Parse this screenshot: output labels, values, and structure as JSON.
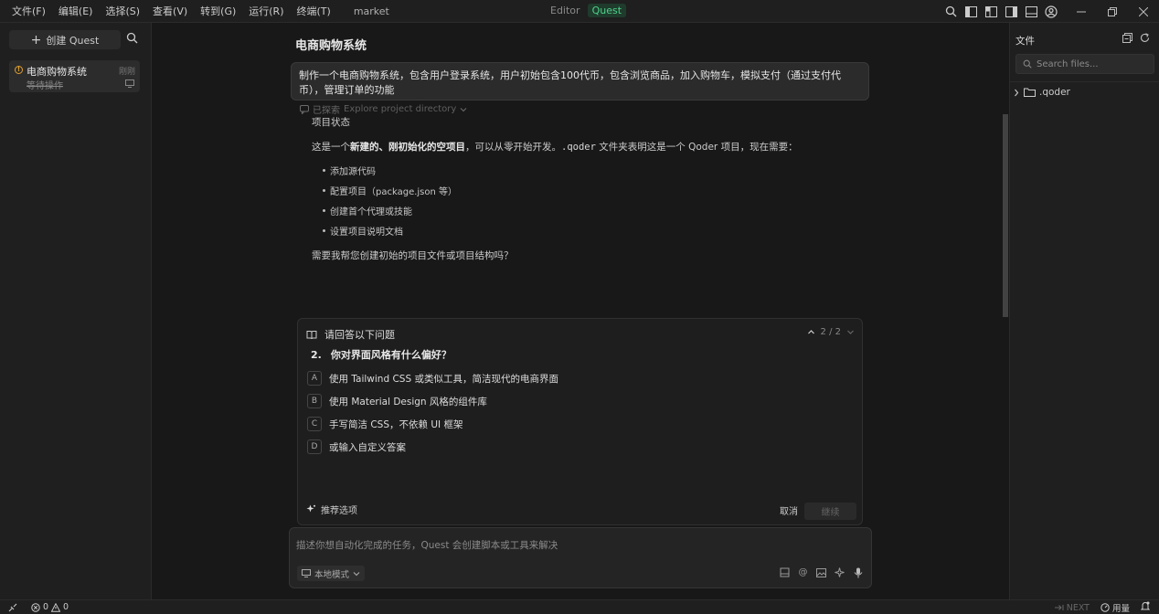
{
  "menu": [
    "文件(F)",
    "编辑(E)",
    "选择(S)",
    "查看(V)",
    "转到(G)",
    "运行(R)",
    "终端(T)"
  ],
  "project_name": "market",
  "mode": {
    "editor": "Editor",
    "quest": "Quest"
  },
  "sidebar": {
    "create_label": "创建 Quest",
    "quest": {
      "title": "电商购物系统",
      "time": "刚刚",
      "status": "等待操作"
    }
  },
  "main": {
    "title": "电商购物系统",
    "user_message": "制作一个电商购物系统，包含用户登录系统，用户初始包含100代币，包含浏览商品，加入购物车，模拟支付（通过支付代币），管理订单的功能",
    "explore_done": "已探索",
    "explore_label": "Explore project directory",
    "answer": {
      "heading": "项目状态",
      "para_prefix": "这是一个",
      "para_bold": "新建的、刚初始化的空项目",
      "para_mid": "，可以从零开始开发。",
      "para_code": ".qoder",
      "para_suffix": " 文件夹表明这是一个 Qoder 项目，现在需要：",
      "items": [
        "添加源代码",
        "配置项目（package.json 等）",
        "创建首个代理或技能",
        "设置项目说明文档"
      ],
      "question": "需要我帮您创建初始的项目文件或项目结构吗？"
    }
  },
  "question_card": {
    "header": "请回答以下问题",
    "pager": "2 / 2",
    "number": "2.",
    "question": "你对界面风格有什么偏好？",
    "options": [
      {
        "letter": "A",
        "text": "使用 Tailwind CSS 或类似工具，简洁现代的电商界面"
      },
      {
        "letter": "B",
        "text": "使用 Material Design 风格的组件库"
      },
      {
        "letter": "C",
        "text": "手写简洁 CSS，不依赖 UI 框架"
      },
      {
        "letter": "D",
        "text": "或输入自定义答案"
      }
    ],
    "recommend": "推荐选项",
    "cancel": "取消",
    "continue": "继续"
  },
  "input": {
    "placeholder": "描述你想自动化完成的任务，Quest 会创建脚本或工具来解决",
    "mode": "本地模式"
  },
  "right_sidebar": {
    "title": "文件",
    "search_placeholder": "Search files...",
    "folder": ".qoder"
  },
  "statusbar": {
    "errors": "0",
    "warnings": "0",
    "next": "NEXT",
    "usage": "用量"
  }
}
